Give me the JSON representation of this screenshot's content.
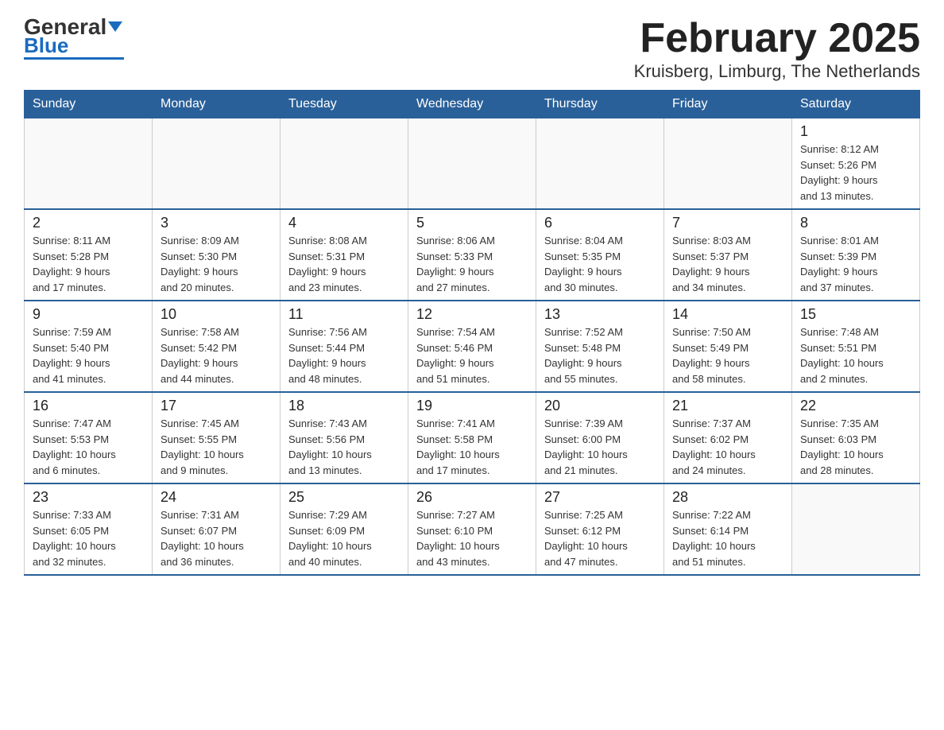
{
  "logo": {
    "name_part1": "General",
    "name_part2": "Blue"
  },
  "title": "February 2025",
  "subtitle": "Kruisberg, Limburg, The Netherlands",
  "days_of_week": [
    "Sunday",
    "Monday",
    "Tuesday",
    "Wednesday",
    "Thursday",
    "Friday",
    "Saturday"
  ],
  "weeks": [
    [
      {
        "day": "",
        "info": ""
      },
      {
        "day": "",
        "info": ""
      },
      {
        "day": "",
        "info": ""
      },
      {
        "day": "",
        "info": ""
      },
      {
        "day": "",
        "info": ""
      },
      {
        "day": "",
        "info": ""
      },
      {
        "day": "1",
        "info": "Sunrise: 8:12 AM\nSunset: 5:26 PM\nDaylight: 9 hours\nand 13 minutes."
      }
    ],
    [
      {
        "day": "2",
        "info": "Sunrise: 8:11 AM\nSunset: 5:28 PM\nDaylight: 9 hours\nand 17 minutes."
      },
      {
        "day": "3",
        "info": "Sunrise: 8:09 AM\nSunset: 5:30 PM\nDaylight: 9 hours\nand 20 minutes."
      },
      {
        "day": "4",
        "info": "Sunrise: 8:08 AM\nSunset: 5:31 PM\nDaylight: 9 hours\nand 23 minutes."
      },
      {
        "day": "5",
        "info": "Sunrise: 8:06 AM\nSunset: 5:33 PM\nDaylight: 9 hours\nand 27 minutes."
      },
      {
        "day": "6",
        "info": "Sunrise: 8:04 AM\nSunset: 5:35 PM\nDaylight: 9 hours\nand 30 minutes."
      },
      {
        "day": "7",
        "info": "Sunrise: 8:03 AM\nSunset: 5:37 PM\nDaylight: 9 hours\nand 34 minutes."
      },
      {
        "day": "8",
        "info": "Sunrise: 8:01 AM\nSunset: 5:39 PM\nDaylight: 9 hours\nand 37 minutes."
      }
    ],
    [
      {
        "day": "9",
        "info": "Sunrise: 7:59 AM\nSunset: 5:40 PM\nDaylight: 9 hours\nand 41 minutes."
      },
      {
        "day": "10",
        "info": "Sunrise: 7:58 AM\nSunset: 5:42 PM\nDaylight: 9 hours\nand 44 minutes."
      },
      {
        "day": "11",
        "info": "Sunrise: 7:56 AM\nSunset: 5:44 PM\nDaylight: 9 hours\nand 48 minutes."
      },
      {
        "day": "12",
        "info": "Sunrise: 7:54 AM\nSunset: 5:46 PM\nDaylight: 9 hours\nand 51 minutes."
      },
      {
        "day": "13",
        "info": "Sunrise: 7:52 AM\nSunset: 5:48 PM\nDaylight: 9 hours\nand 55 minutes."
      },
      {
        "day": "14",
        "info": "Sunrise: 7:50 AM\nSunset: 5:49 PM\nDaylight: 9 hours\nand 58 minutes."
      },
      {
        "day": "15",
        "info": "Sunrise: 7:48 AM\nSunset: 5:51 PM\nDaylight: 10 hours\nand 2 minutes."
      }
    ],
    [
      {
        "day": "16",
        "info": "Sunrise: 7:47 AM\nSunset: 5:53 PM\nDaylight: 10 hours\nand 6 minutes."
      },
      {
        "day": "17",
        "info": "Sunrise: 7:45 AM\nSunset: 5:55 PM\nDaylight: 10 hours\nand 9 minutes."
      },
      {
        "day": "18",
        "info": "Sunrise: 7:43 AM\nSunset: 5:56 PM\nDaylight: 10 hours\nand 13 minutes."
      },
      {
        "day": "19",
        "info": "Sunrise: 7:41 AM\nSunset: 5:58 PM\nDaylight: 10 hours\nand 17 minutes."
      },
      {
        "day": "20",
        "info": "Sunrise: 7:39 AM\nSunset: 6:00 PM\nDaylight: 10 hours\nand 21 minutes."
      },
      {
        "day": "21",
        "info": "Sunrise: 7:37 AM\nSunset: 6:02 PM\nDaylight: 10 hours\nand 24 minutes."
      },
      {
        "day": "22",
        "info": "Sunrise: 7:35 AM\nSunset: 6:03 PM\nDaylight: 10 hours\nand 28 minutes."
      }
    ],
    [
      {
        "day": "23",
        "info": "Sunrise: 7:33 AM\nSunset: 6:05 PM\nDaylight: 10 hours\nand 32 minutes."
      },
      {
        "day": "24",
        "info": "Sunrise: 7:31 AM\nSunset: 6:07 PM\nDaylight: 10 hours\nand 36 minutes."
      },
      {
        "day": "25",
        "info": "Sunrise: 7:29 AM\nSunset: 6:09 PM\nDaylight: 10 hours\nand 40 minutes."
      },
      {
        "day": "26",
        "info": "Sunrise: 7:27 AM\nSunset: 6:10 PM\nDaylight: 10 hours\nand 43 minutes."
      },
      {
        "day": "27",
        "info": "Sunrise: 7:25 AM\nSunset: 6:12 PM\nDaylight: 10 hours\nand 47 minutes."
      },
      {
        "day": "28",
        "info": "Sunrise: 7:22 AM\nSunset: 6:14 PM\nDaylight: 10 hours\nand 51 minutes."
      },
      {
        "day": "",
        "info": ""
      }
    ]
  ]
}
